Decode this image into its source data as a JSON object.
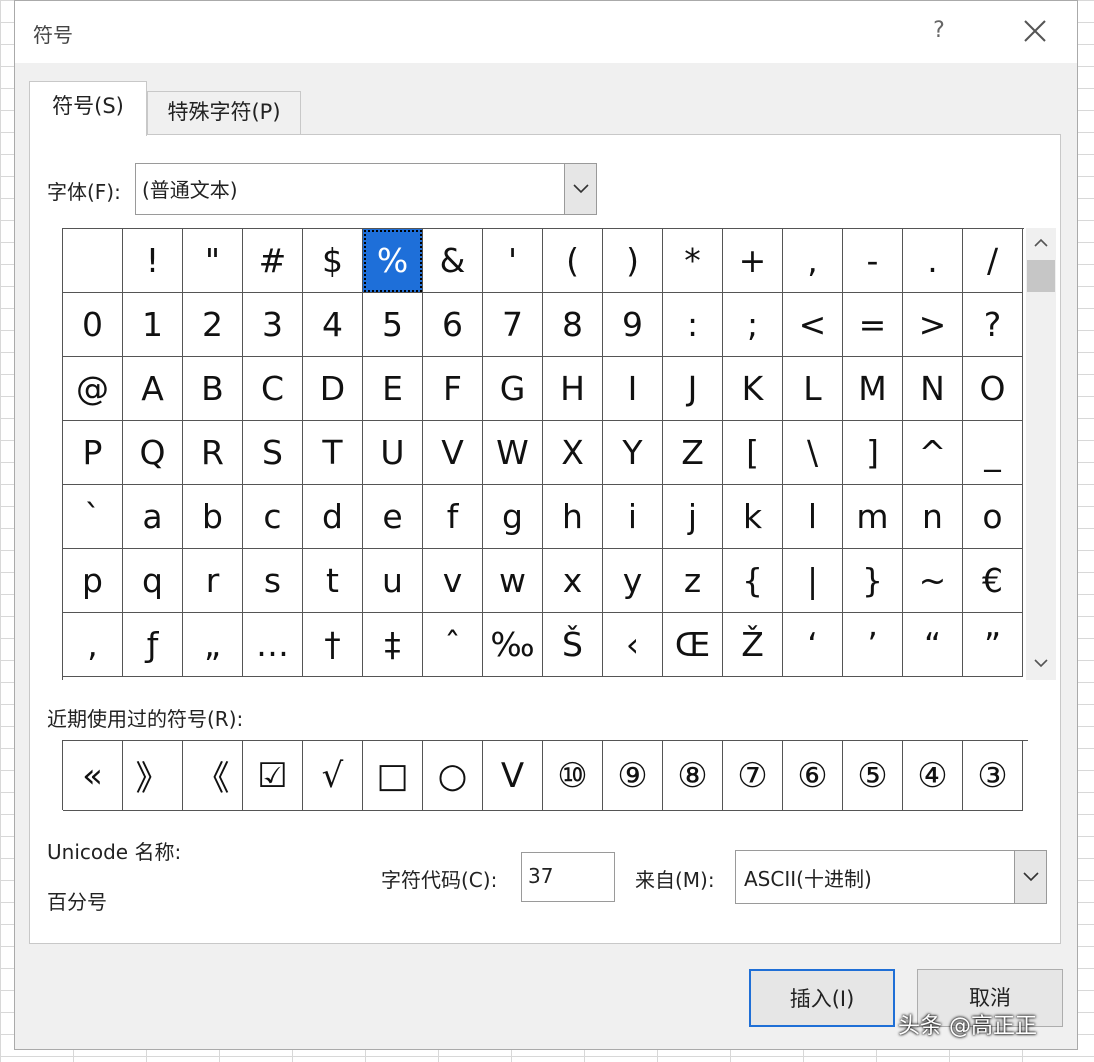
{
  "dialog": {
    "title": "符号",
    "help": "?",
    "tabs": {
      "symbols": "符号(S)",
      "special": "特殊字符(P)"
    }
  },
  "font": {
    "label": "字体(F):",
    "value": "(普通文本)"
  },
  "symbols": [
    " ",
    "!",
    "\"",
    "#",
    "$",
    "%",
    "&",
    "'",
    "(",
    ")",
    "*",
    "+",
    ",",
    "-",
    ".",
    "/",
    "0",
    "1",
    "2",
    "3",
    "4",
    "5",
    "6",
    "7",
    "8",
    "9",
    ":",
    ";",
    "<",
    "=",
    ">",
    "?",
    "@",
    "A",
    "B",
    "C",
    "D",
    "E",
    "F",
    "G",
    "H",
    "I",
    "J",
    "K",
    "L",
    "M",
    "N",
    "O",
    "P",
    "Q",
    "R",
    "S",
    "T",
    "U",
    "V",
    "W",
    "X",
    "Y",
    "Z",
    "[",
    "\\",
    "]",
    "^",
    "_",
    "`",
    "a",
    "b",
    "c",
    "d",
    "e",
    "f",
    "g",
    "h",
    "i",
    "j",
    "k",
    "l",
    "m",
    "n",
    "o",
    "p",
    "q",
    "r",
    "s",
    "t",
    "u",
    "v",
    "w",
    "x",
    "y",
    "z",
    "{",
    "|",
    "}",
    "~",
    "€",
    ",",
    "ƒ",
    "„",
    "…",
    "†",
    "‡",
    "ˆ",
    "‰",
    "Š",
    "‹",
    "Œ",
    "Ž",
    "‘",
    "’",
    "“",
    "”"
  ],
  "selected_symbol": "%",
  "recent": {
    "label": "近期使用过的符号(R):",
    "items": [
      "«",
      "》",
      "《",
      "☑",
      "√",
      "□",
      "○",
      "V",
      "⑩",
      "⑨",
      "⑧",
      "⑦",
      "⑥",
      "⑤",
      "④",
      "③"
    ]
  },
  "unicode": {
    "label": "Unicode 名称:",
    "name": "百分号"
  },
  "char_code": {
    "label": "字符代码(C):",
    "value": "37"
  },
  "from": {
    "label": "来自(M):",
    "value": "ASCII(十进制)"
  },
  "buttons": {
    "insert": "插入(I)",
    "cancel": "取消"
  },
  "watermark": "头条 @高正正"
}
